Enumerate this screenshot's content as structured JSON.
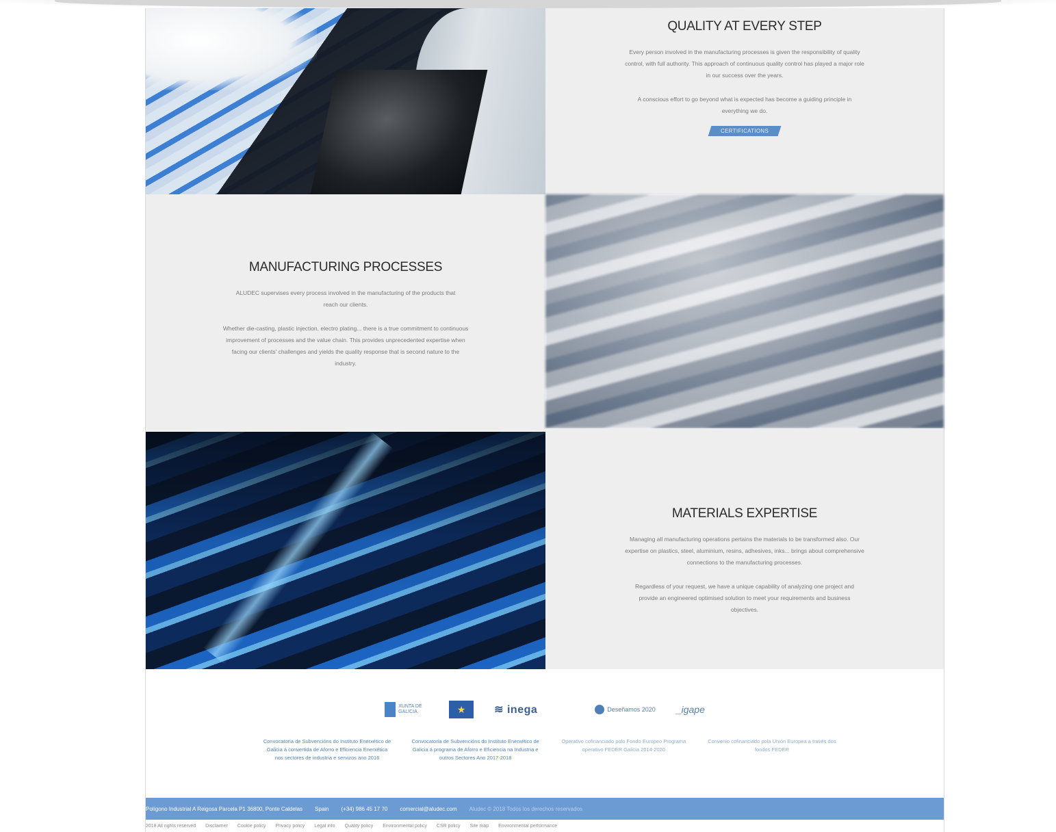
{
  "sections": {
    "quality": {
      "title": "QUALITY AT EVERY STEP",
      "p1": "Every person involved in the manufacturing processes is given the responsibility of quality control, with full authority. This approach of continuous quality control has played a major role in our success over the years.",
      "p2": "A conscious effort to go beyond what is expected has become a guiding principle in everything we do.",
      "button_label": "CERTIFICATIONS"
    },
    "manufacturing": {
      "title": "MANUFACTURING PROCESSES",
      "p1": "ALUDEC supervises every process involved in the manufacturing of the products that reach our clients.",
      "p2": "Whether die-casting, plastic injection, electro plating... there is a true commitment to continuous improvement of processes and the value chain. This provides unprecedented expertise when facing our clients' challenges and yields the quality response that is second nature to the industry."
    },
    "materials": {
      "title": "MATERIALS EXPERTISE",
      "p1": "Managing all manufacturing operations pertains the materials to be transformed also. Our expertise on plastics, steel, aluminium, resins, adhesives, inks... brings about comprehensive connections to the manufacturing processes.",
      "p2": "Regardless of your request, we have a unique capability of analyzing one project and provide an engineered optimised solution to meet your requirements and business objectives."
    }
  },
  "logos": {
    "xunta": "XUNTA DE GALICIA",
    "eu": "★",
    "inega": "≋ inega",
    "inega_sub": "",
    "feder": "Deseñamos 2020",
    "igape": "_igape"
  },
  "grants": [
    "Convocatoria de Subvencións do Instituto Enerxético de Galicia á convertida de Aforro e Eficiencia Enerxética nos sectores de industria e servizos ano 2016",
    "Convocatoria de Subvencións do Instituto Enerxético de Galicia á programa de Aforro e Eficiencia na Industria e outros Sectores Ano 2017-2018",
    "Operativo cofinanciado polo Fondo Europeo Programa operativo FEDER Galicia 2014-2020",
    "Convenio cofinanciado pola Unión Europea a través dos fondos FEDER"
  ],
  "footer": {
    "address": "Polígono Industrial A Reigosa Parcela P1 36800, Ponte Caldelas",
    "country": "Spain",
    "phone": "(+34) 986 45 17 70",
    "email": "comercial@aludec.com",
    "extra": "Aludec © 2018 Todos los derechos reservados"
  },
  "legal_links": [
    "2018 All rights reserved",
    "Disclaimer",
    "Cookie policy",
    "Privacy policy",
    "Legal info",
    "Quality policy",
    "Environmental policy",
    "CSR policy",
    "Site map",
    "Environmental performance"
  ]
}
